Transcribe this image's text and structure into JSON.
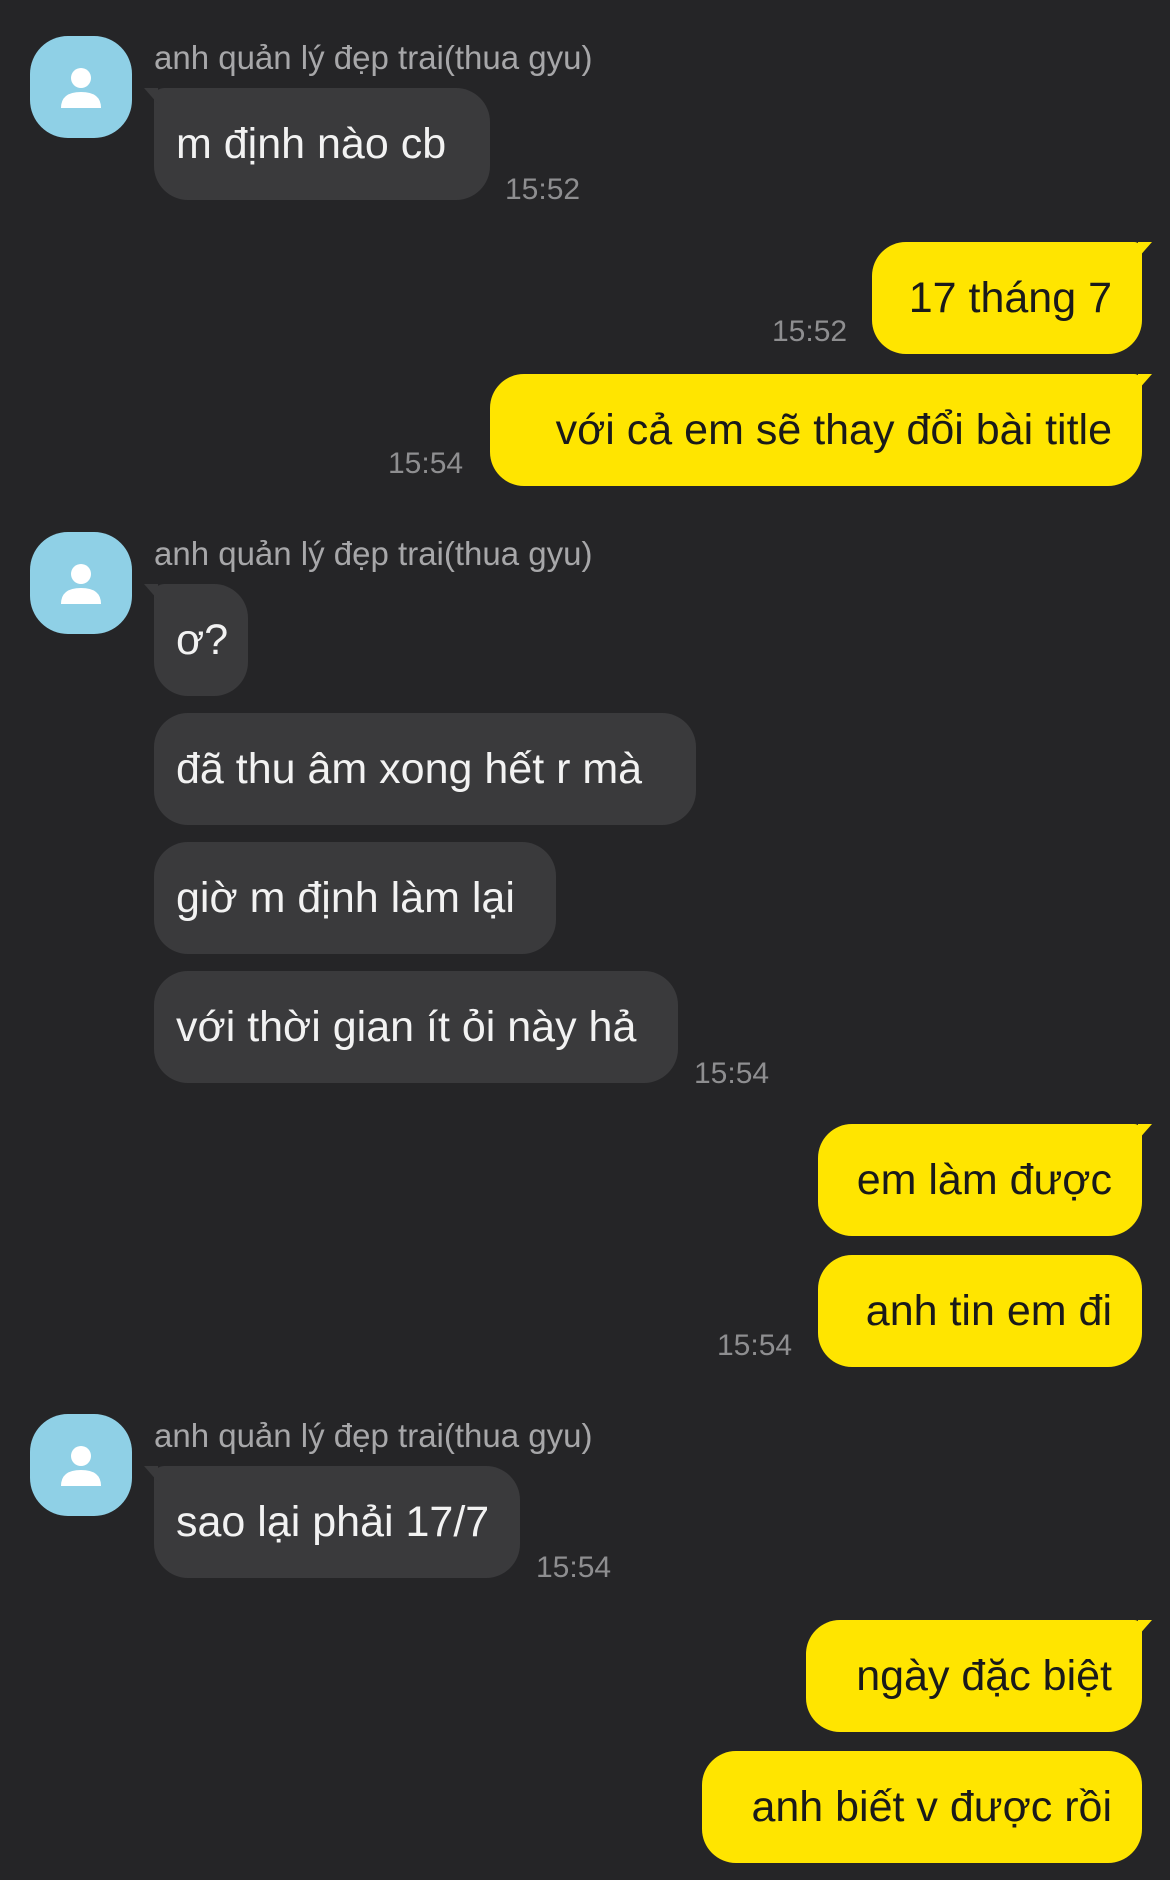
{
  "contact": {
    "name": "anh quản lý đẹp trai(thua gyu)"
  },
  "messages": [
    {
      "text": "m định nào cb",
      "time": "15:52"
    },
    {
      "text": "17 tháng 7",
      "time": "15:52"
    },
    {
      "text": "với cả em sẽ thay đổi bài title",
      "time": "15:54"
    },
    {
      "text": "ơ?"
    },
    {
      "text": "đã thu âm xong hết r mà"
    },
    {
      "text": "giờ m định làm lại"
    },
    {
      "text": "với thời gian ít ỏi này hả",
      "time": "15:54"
    },
    {
      "text": "em làm được"
    },
    {
      "text": "anh tin em đi",
      "time": "15:54"
    },
    {
      "text": "sao lại phải 17/7",
      "time": "15:54"
    },
    {
      "text": "ngày đặc biệt"
    },
    {
      "text": "anh biết v được rồi"
    }
  ],
  "colors": {
    "background": "#252527",
    "incoming": "#3a3a3c",
    "outgoing": "#ffe500",
    "avatar": "#8fd0e6"
  },
  "icons": {
    "avatar": "person-icon"
  }
}
